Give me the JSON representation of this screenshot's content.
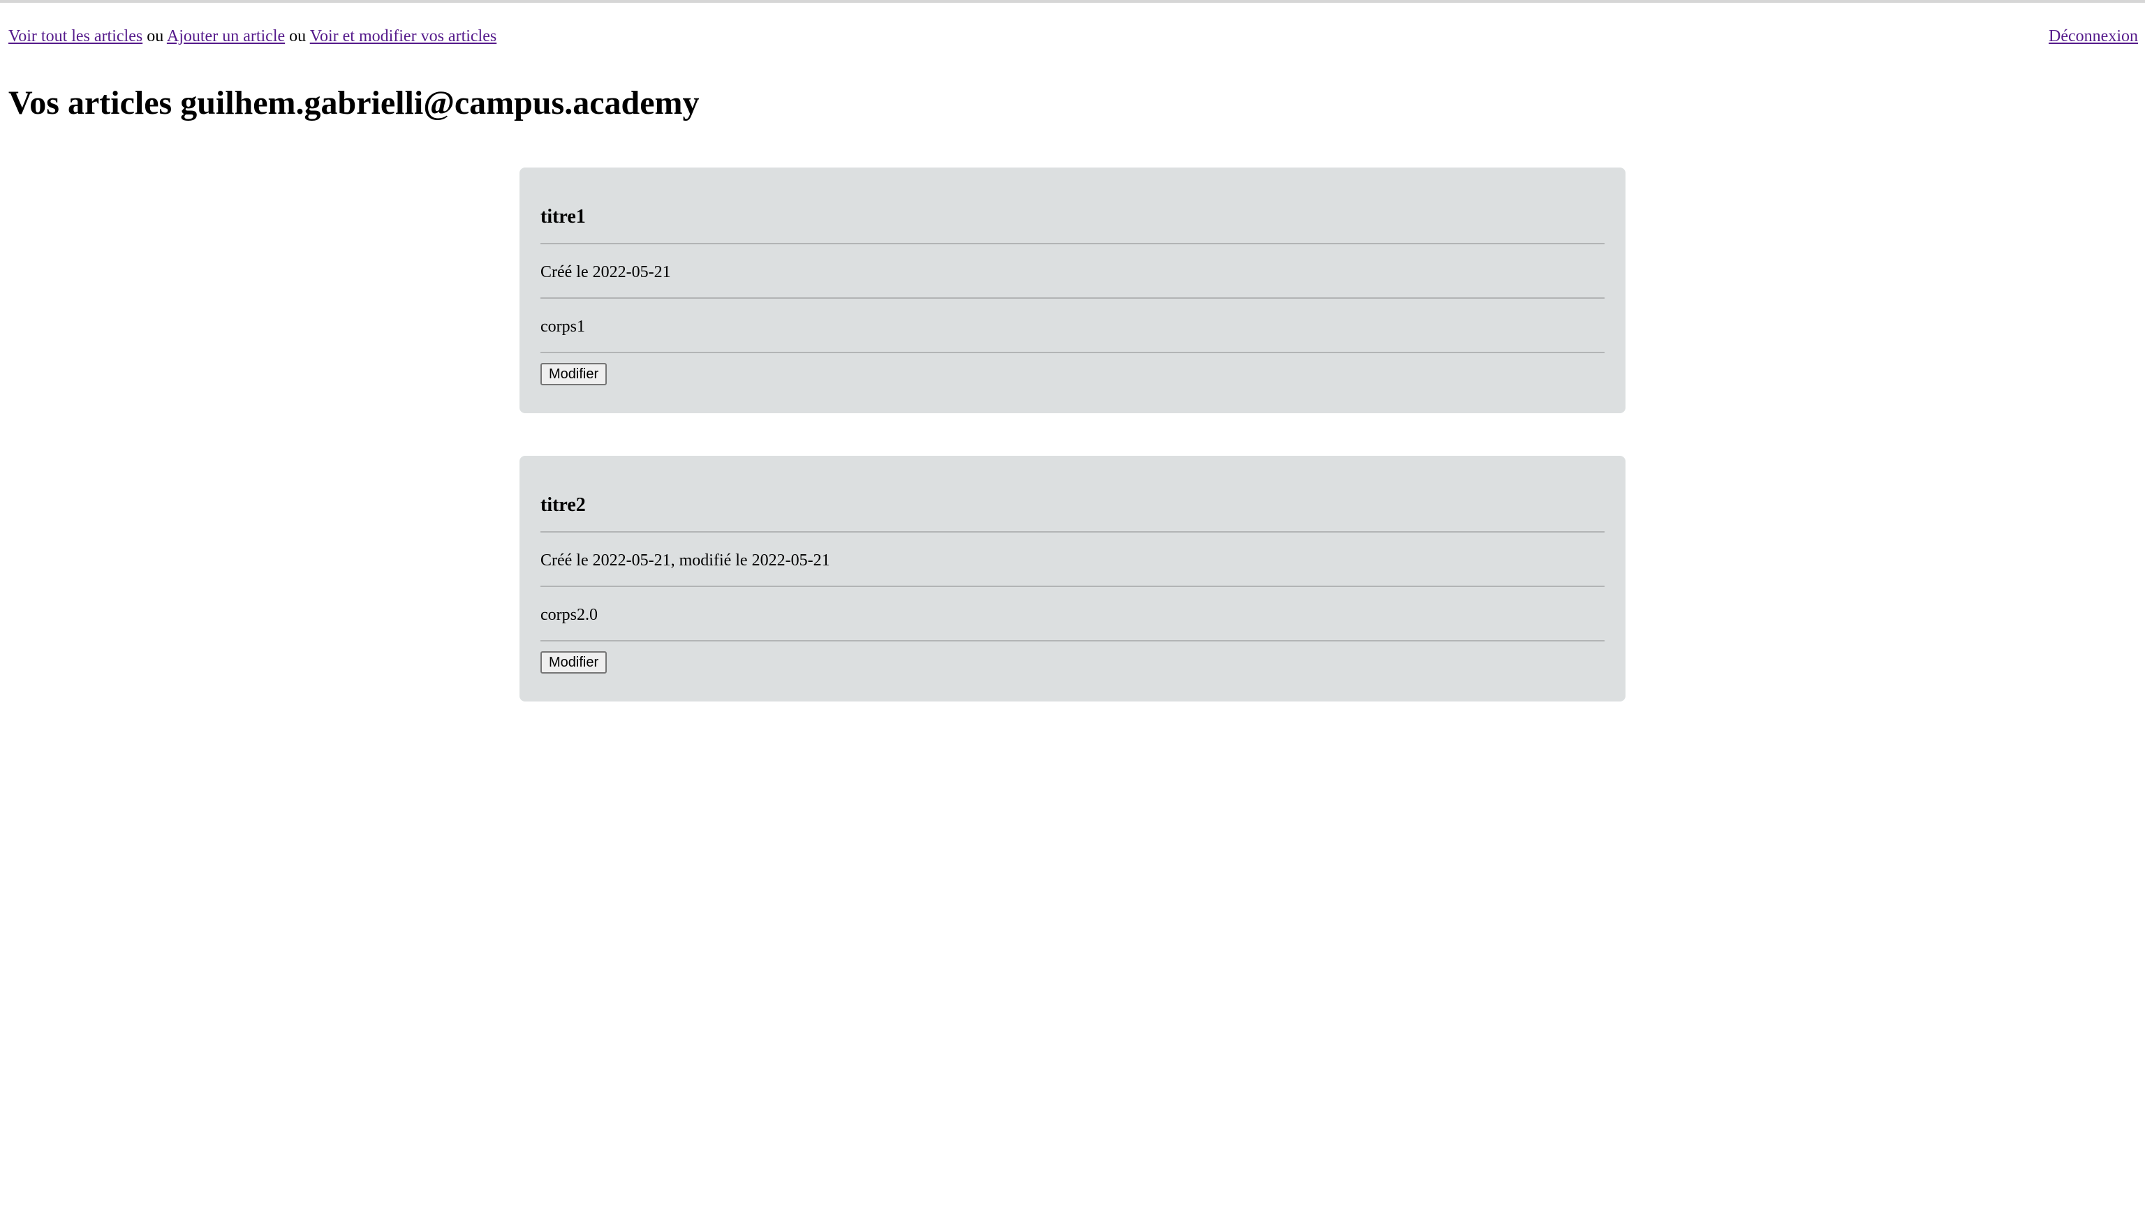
{
  "nav": {
    "link_all": "Voir tout les articles",
    "sep1": "ou",
    "link_add": "Ajouter un article",
    "sep2": "ou",
    "link_mine": "Voir et modifier vos articles",
    "logout": "Déconnexion"
  },
  "page": {
    "title": "Vos articles guilhem.gabrielli@campus.academy"
  },
  "articles": [
    {
      "title": "titre1",
      "meta": "Créé le 2022-05-21",
      "body": "corps1",
      "button": "Modifier"
    },
    {
      "title": "titre2",
      "meta": "Créé le 2022-05-21, modifié le 2022-05-21",
      "body": "corps2.0",
      "button": "Modifier"
    }
  ],
  "colors": {
    "link": "#551a8b",
    "card_background": "#dcdfe0",
    "divider": "#b2b4b5"
  }
}
